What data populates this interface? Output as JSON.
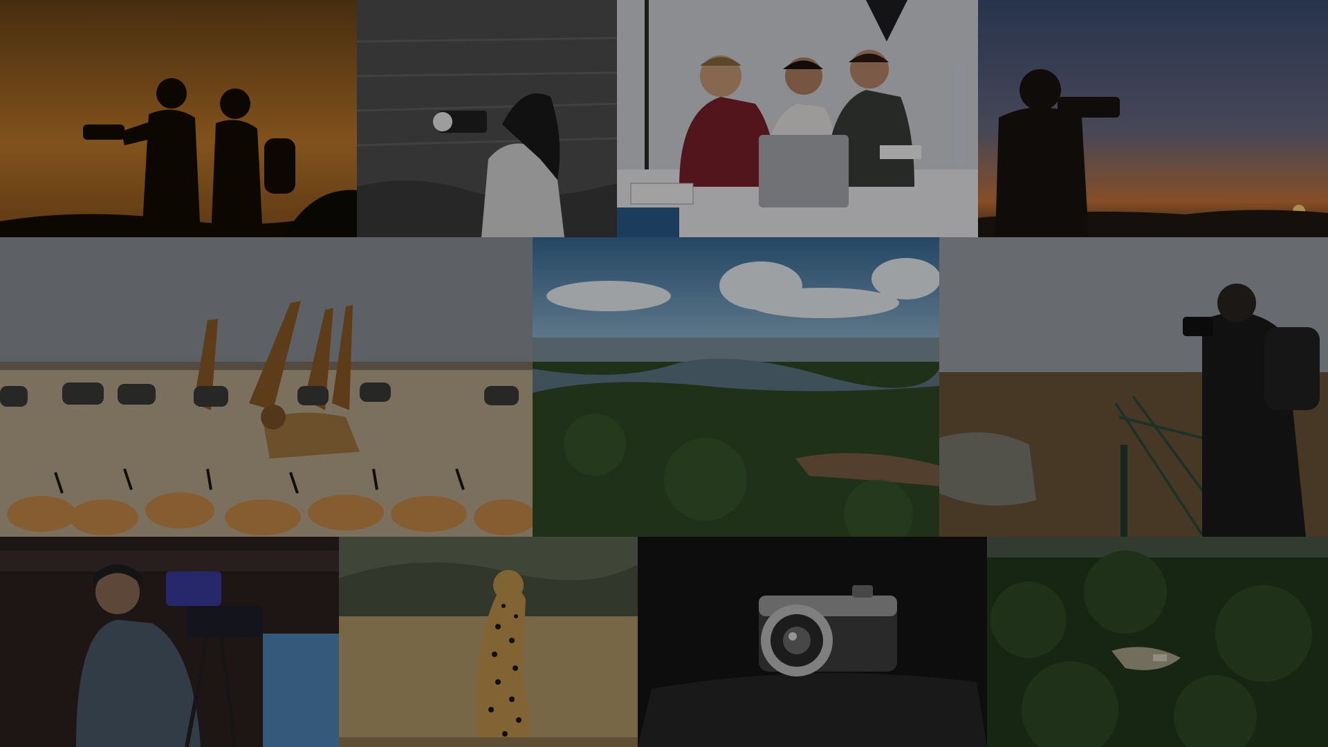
{
  "collage": {
    "tiles": [
      {
        "id": "silhouette-duo-sunset",
        "subject": "two-photographers-silhouette"
      },
      {
        "id": "woman-camera-seaside",
        "subject": "photographer-by-sea"
      },
      {
        "id": "team-laptop-studio",
        "subject": "three-people-at-laptop"
      },
      {
        "id": "photographer-sunset-hills",
        "subject": "photographer-silhouette-sunset"
      },
      {
        "id": "savanna-wildlife",
        "subject": "giraffes-lion-antelopes"
      },
      {
        "id": "aerial-river-forest",
        "subject": "aerial-rainforest-river"
      },
      {
        "id": "photographer-marsh-bridge",
        "subject": "photographer-on-bridge"
      },
      {
        "id": "studio-video-camera",
        "subject": "camera-operator"
      },
      {
        "id": "cheetah-grassland",
        "subject": "cheetah-sitting"
      },
      {
        "id": "mirrorless-camera-bw",
        "subject": "compact-camera"
      },
      {
        "id": "aerial-forest-clearing",
        "subject": "aerial-forest"
      }
    ],
    "colors": {
      "sunset-orange": "#c17a2a",
      "sea-gray": "#6b6b6b",
      "studio-white": "#d8d8dc",
      "dusk-blue": "#5a6a8a",
      "savanna-sand": "#b8a88a",
      "sky-blue": "#3d6f9a",
      "forest-green": "#2f4a25",
      "marsh-brown": "#6a5438"
    }
  }
}
